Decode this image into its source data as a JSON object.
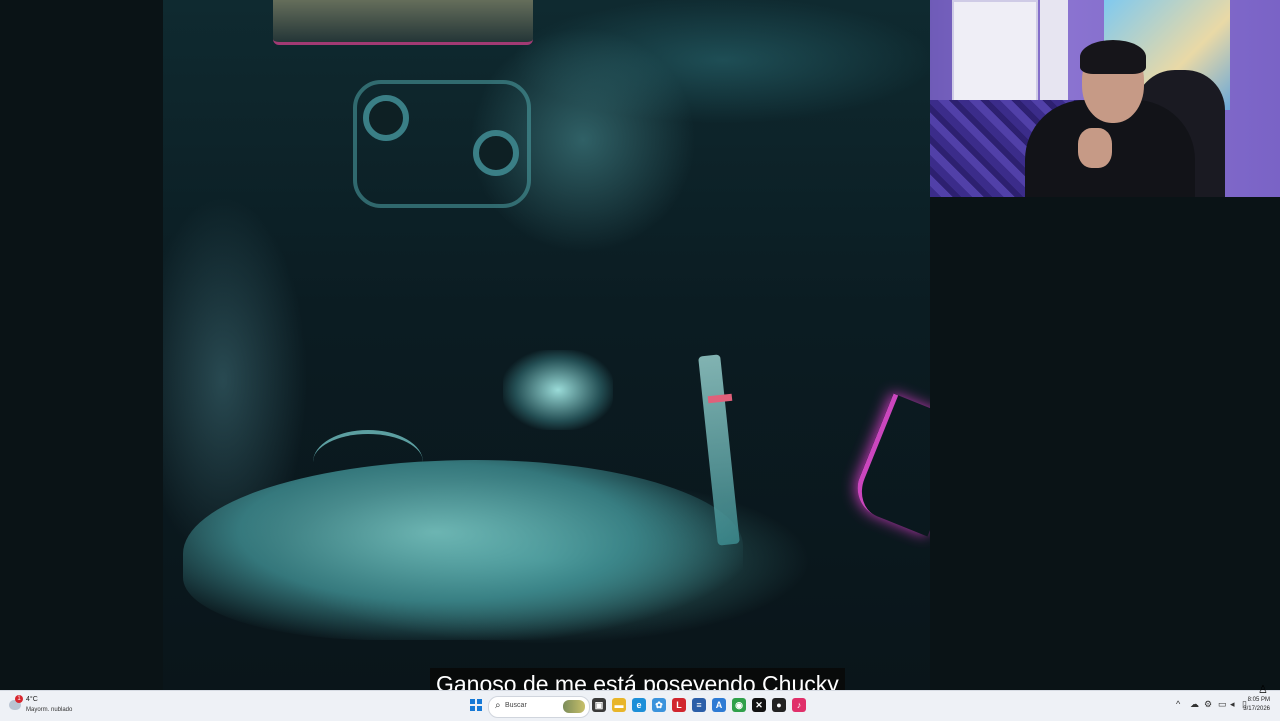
{
  "subtitle": {
    "text": "Ganoso de me está poseyendo Chucky"
  },
  "taskbar": {
    "weather": {
      "temp": "4°C",
      "desc": "Mayorm. nublado",
      "badge": "1"
    },
    "search": {
      "placeholder": "Buscar"
    },
    "apps": [
      {
        "name": "task-view",
        "glyph": "▣",
        "color": "#3a3a3a"
      },
      {
        "name": "file-explorer",
        "glyph": "▬",
        "color": "#e8b52a"
      },
      {
        "name": "edge",
        "glyph": "e",
        "color": "#1d8fd8"
      },
      {
        "name": "photos",
        "glyph": "✿",
        "color": "#3b93dc"
      },
      {
        "name": "red-app",
        "glyph": "L",
        "color": "#d1262e"
      },
      {
        "name": "word",
        "glyph": "≡",
        "color": "#2b5ea8"
      },
      {
        "name": "blue-app",
        "glyph": "A",
        "color": "#2e7bd4"
      },
      {
        "name": "chrome",
        "glyph": "◉",
        "color": "#30a04a"
      },
      {
        "name": "capcut",
        "glyph": "✕",
        "color": "#111111"
      },
      {
        "name": "dark-app",
        "glyph": "●",
        "color": "#222222"
      },
      {
        "name": "tiktok",
        "glyph": "♪",
        "color": "#e0306a"
      }
    ],
    "tray": [
      "^",
      "☁",
      "⚙",
      "🎤",
      "▭",
      "🔊",
      "🔋"
    ],
    "clock": {
      "time": "8:05 PM",
      "date": "3/17/2026"
    }
  },
  "colors": {
    "taskbar": "#eef1f6",
    "accent_pink": "#e04bd0",
    "teal": "#4fa4a8"
  }
}
